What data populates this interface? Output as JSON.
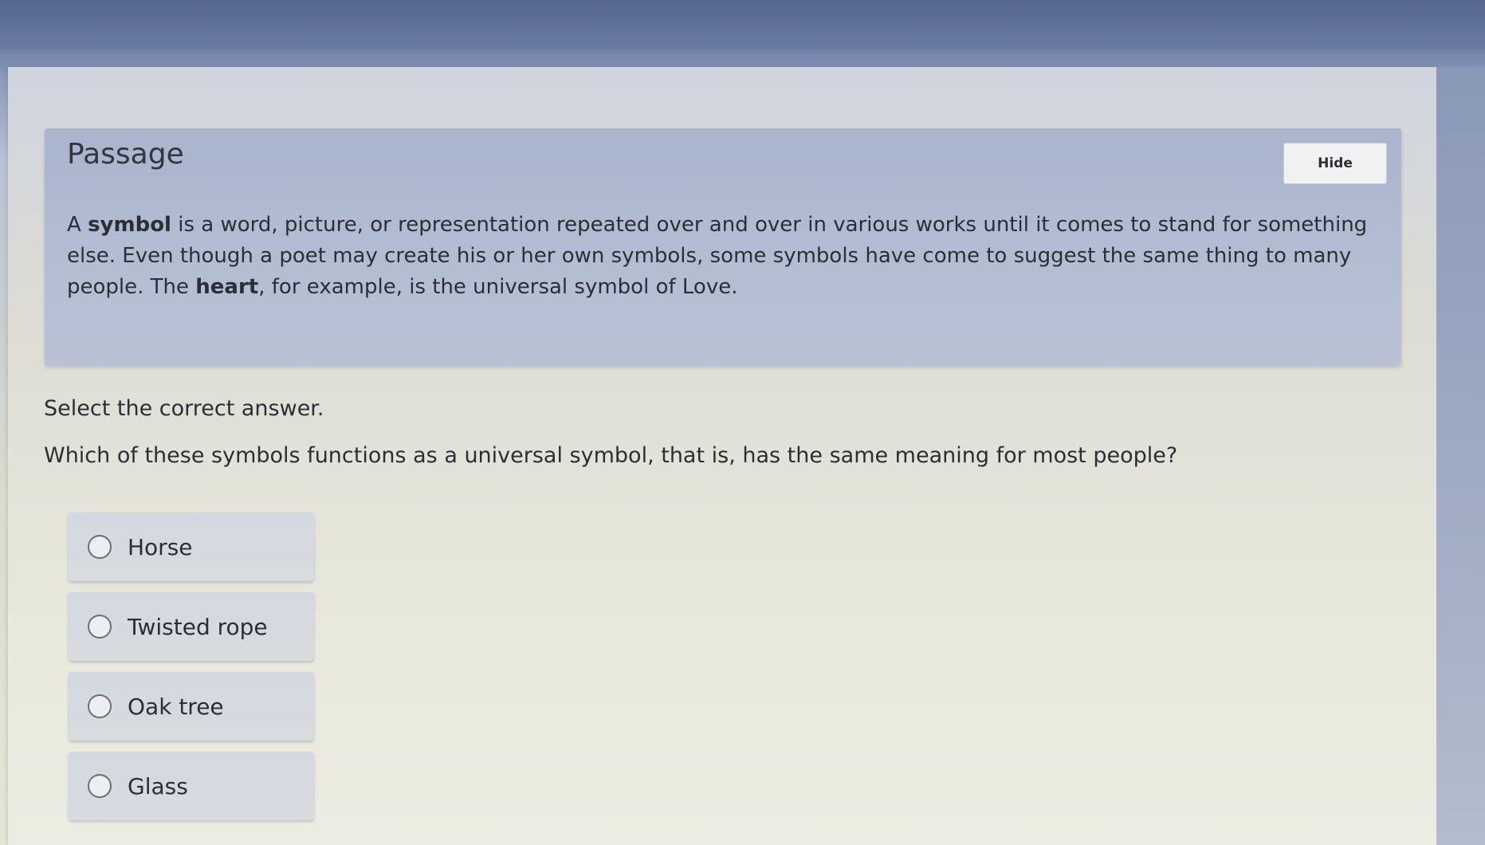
{
  "passage": {
    "title": "Passage",
    "hide_label": "Hide",
    "text_1": "A ",
    "term_symbol": "symbol",
    "text_2": " is a word, picture, or representation repeated over and over in various works until it comes to stand for something else. Even though a poet may create his or her own symbols, some symbols have come to suggest the same thing to many people. The ",
    "term_heart": "heart",
    "text_3": ", for example, is the universal symbol of Love."
  },
  "question": {
    "instruction": "Select the correct answer.",
    "prompt": "Which of these symbols functions as a universal symbol, that is, has the same meaning for most people?",
    "options": [
      {
        "label": "Horse"
      },
      {
        "label": "Twisted rope"
      },
      {
        "label": "Oak tree"
      },
      {
        "label": "Glass"
      }
    ]
  },
  "icons": {
    "radio": "radio-unchecked-icon"
  }
}
